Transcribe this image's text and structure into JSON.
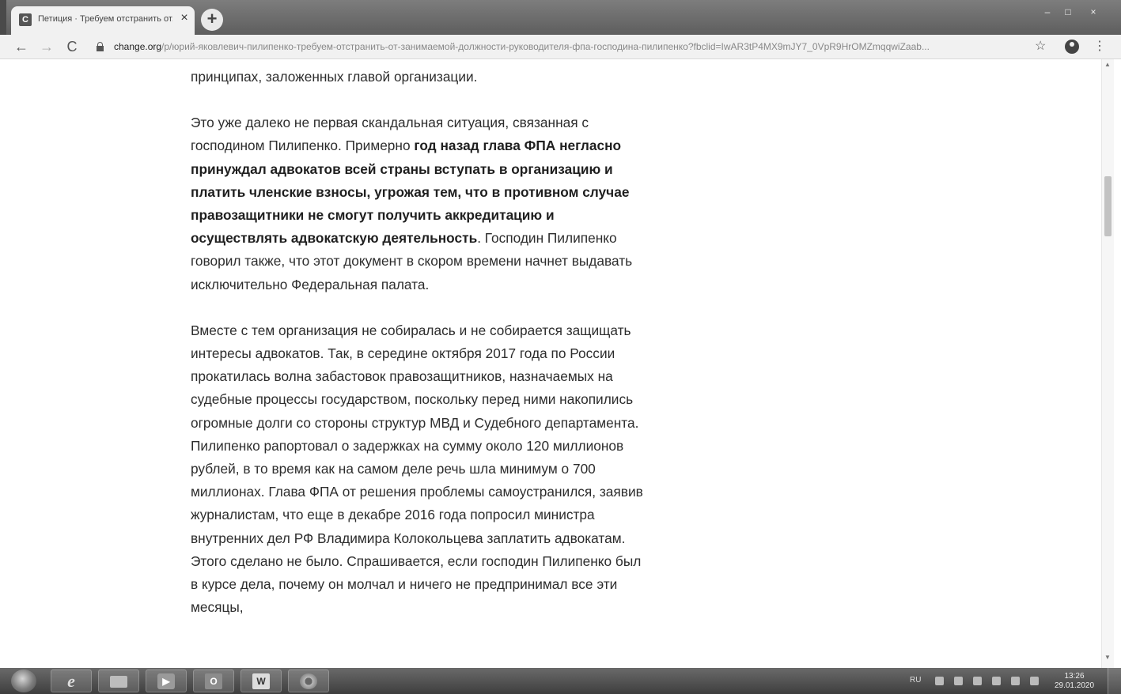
{
  "browser": {
    "tab": {
      "favicon_letter": "C",
      "title": "Петиция · Требуем отстранить от...",
      "close_glyph": "×"
    },
    "new_tab_glyph": "+",
    "window_controls": {
      "minimize": "–",
      "maximize": "□",
      "close": "×"
    },
    "nav": {
      "back_glyph": "←",
      "forward_glyph": "→",
      "reload_glyph": "C"
    },
    "address": {
      "host": "change.org",
      "path": "/p/юрий-яковлевич-пилипенко-требуем-отстранить-от-занимаемой-должности-руководителя-фпа-господина-пилипенко?fbclid=IwAR3tP4MX9mJY7_0VpR9HrOMZmqqwiZaab..."
    },
    "star_glyph": "☆",
    "menu_glyph": "⋮"
  },
  "article": {
    "p0": "принципах, заложенных главой организации.",
    "p1_a": "Это уже далеко не первая скандальная ситуация, связанная с господином Пилипенко. Примерно ",
    "p1_bold": "год назад глава ФПА негласно принуждал адвокатов всей страны вступать в организацию и платить членские взносы, угрожая тем, что в противном случае правозащитники не смогут получить аккредитацию и осуществлять адвокатскую деятельность",
    "p1_b": ". Господин Пилипенко говорил также, что этот документ в скором времени начнет выдавать исключительно Федеральная палата.",
    "p2": "Вместе с тем организация не собиралась и не собирается защищать интересы адвокатов. Так, в середине октября 2017 года по России прокатилась волна забастовок правозащитников, назначаемых на судебные процессы государством, поскольку перед ними накопились огромные долги со стороны структур МВД и Судебного департамента. Пилипенко рапортовал о задержках на сумму около 120 миллионов рублей, в то время как на самом деле речь шла минимум о 700 миллионах. Глава ФПА от решения проблемы самоустранился, заявив журналистам, что еще в декабре 2016 года попросил министра внутренних дел РФ Владимира Колокольцева заплатить адвокатам. Этого сделано не было. Спрашивается, если господин Пилипенко был в курсе дела, почему он молчал и ничего не предпринимал все эти месяцы,"
  },
  "taskbar": {
    "ie_glyph": "e",
    "media_glyph": "▶",
    "outlook_glyph": "O",
    "word_glyph": "W",
    "language": "RU",
    "clock_time": "13:26",
    "clock_date": "29.01.2020"
  }
}
